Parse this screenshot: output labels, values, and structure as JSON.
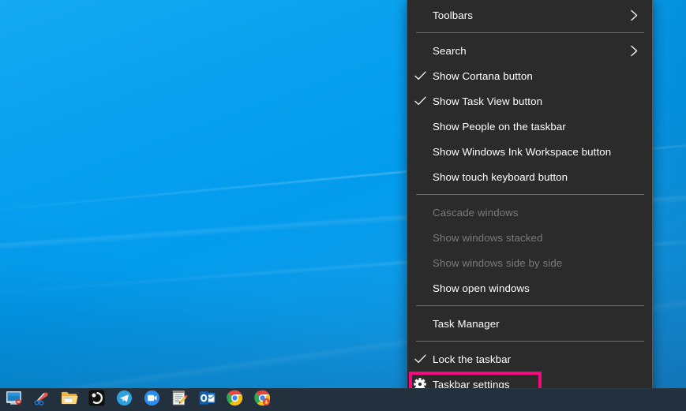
{
  "desktop": {
    "wallpaper_name": "windows-10-blue-hero-wallpaper",
    "wallpaper_color": "#0b9bea"
  },
  "context_menu": {
    "name": "taskbar-context-menu",
    "background_color": "#2b2b2b",
    "border_color": "#5a5a5a",
    "text_color": "#ffffff",
    "disabled_text_color": "#7a7a7a",
    "separator_color": "#6e6e6e",
    "groups": [
      {
        "items": [
          {
            "label": "Toolbars",
            "checked": false,
            "disabled": false,
            "submenu": true,
            "icon": null
          }
        ]
      },
      {
        "items": [
          {
            "label": "Search",
            "checked": false,
            "disabled": false,
            "submenu": true,
            "icon": null
          },
          {
            "label": "Show Cortana button",
            "checked": true,
            "disabled": false,
            "submenu": false,
            "icon": null
          },
          {
            "label": "Show Task View button",
            "checked": true,
            "disabled": false,
            "submenu": false,
            "icon": null
          },
          {
            "label": "Show People on the taskbar",
            "checked": false,
            "disabled": false,
            "submenu": false,
            "icon": null
          },
          {
            "label": "Show Windows Ink Workspace button",
            "checked": false,
            "disabled": false,
            "submenu": false,
            "icon": null
          },
          {
            "label": "Show touch keyboard button",
            "checked": false,
            "disabled": false,
            "submenu": false,
            "icon": null
          }
        ]
      },
      {
        "items": [
          {
            "label": "Cascade windows",
            "checked": false,
            "disabled": true,
            "submenu": false,
            "icon": null
          },
          {
            "label": "Show windows stacked",
            "checked": false,
            "disabled": true,
            "submenu": false,
            "icon": null
          },
          {
            "label": "Show windows side by side",
            "checked": false,
            "disabled": true,
            "submenu": false,
            "icon": null
          },
          {
            "label": "Show open windows",
            "checked": false,
            "disabled": false,
            "submenu": false,
            "icon": null
          }
        ]
      },
      {
        "items": [
          {
            "label": "Task Manager",
            "checked": false,
            "disabled": false,
            "submenu": false,
            "icon": null
          }
        ]
      },
      {
        "items": [
          {
            "label": "Lock the taskbar",
            "checked": true,
            "disabled": false,
            "submenu": false,
            "icon": null
          },
          {
            "label": "Taskbar settings",
            "checked": false,
            "disabled": false,
            "submenu": false,
            "icon": "gear-icon",
            "highlighted": true
          }
        ]
      }
    ]
  },
  "highlight": {
    "name": "taskbar-settings-highlight",
    "color": "#f5097f",
    "target_label": "Taskbar settings"
  },
  "taskbar": {
    "background_color": "#23303d",
    "icons": [
      {
        "name": "show-desktop-peek-icon",
        "title": "Show desktop"
      },
      {
        "name": "snipping-tool-icon",
        "title": "Snipping Tool"
      },
      {
        "name": "file-explorer-icon",
        "title": "File Explorer"
      },
      {
        "name": "obs-studio-icon",
        "title": "OBS Studio"
      },
      {
        "name": "telegram-icon",
        "title": "Telegram"
      },
      {
        "name": "zoom-icon",
        "title": "Zoom"
      },
      {
        "name": "notepad-icon",
        "title": "Notepad"
      },
      {
        "name": "outlook-icon",
        "title": "Outlook"
      },
      {
        "name": "google-chrome-icon",
        "title": "Google Chrome"
      },
      {
        "name": "google-chrome-beta-icon",
        "title": "Google Chrome Beta"
      }
    ]
  }
}
